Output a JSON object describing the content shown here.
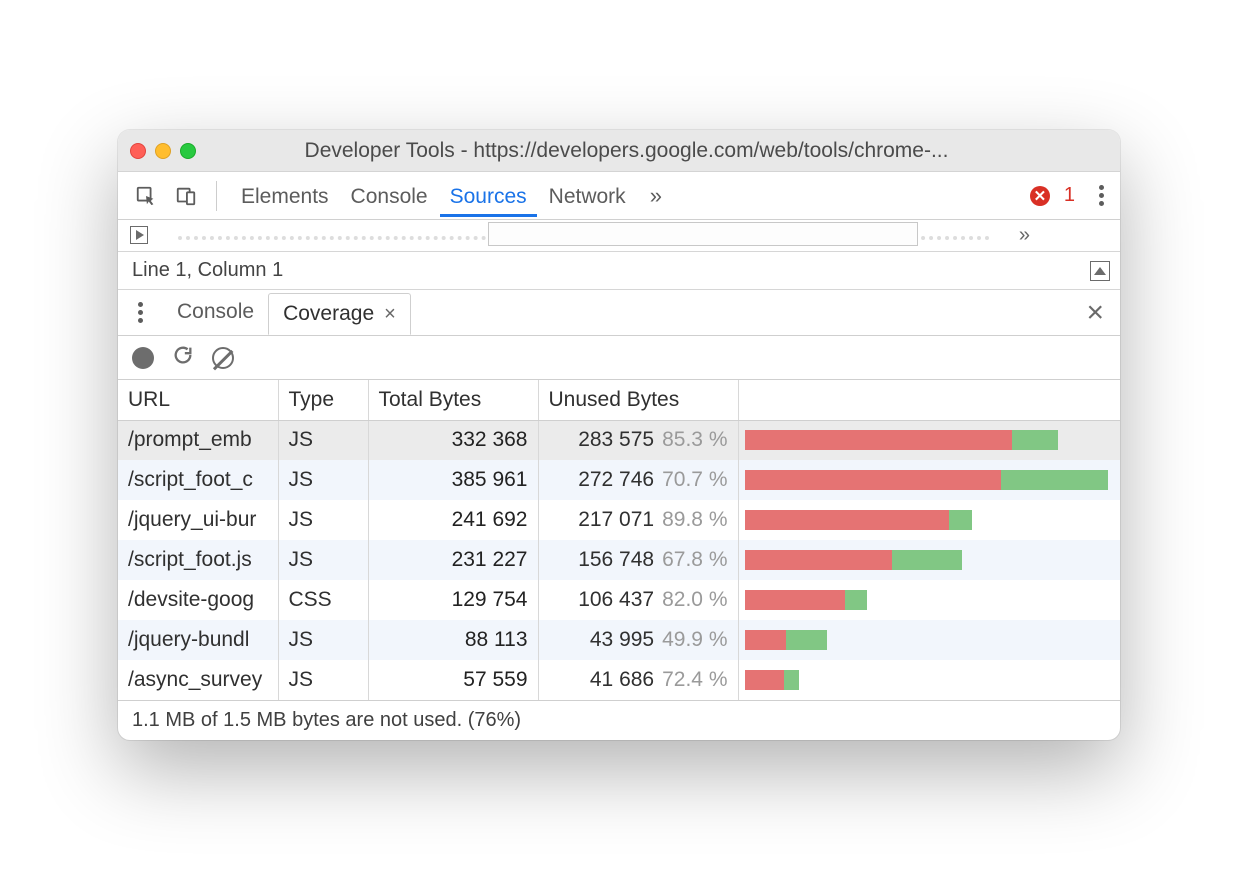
{
  "window": {
    "title": "Developer Tools - https://developers.google.com/web/tools/chrome-..."
  },
  "maintabs": {
    "items": [
      "Elements",
      "Console",
      "Sources",
      "Network"
    ],
    "active_index": 2,
    "error_count": "1"
  },
  "statusline": {
    "text": "Line 1, Column 1"
  },
  "drawer": {
    "tabs": [
      "Console",
      "Coverage"
    ],
    "active_index": 1
  },
  "coverage": {
    "headers": {
      "url": "URL",
      "type": "Type",
      "total": "Total Bytes",
      "unused": "Unused Bytes"
    },
    "max_total": 385961,
    "rows": [
      {
        "url": "/prompt_emb",
        "type": "JS",
        "total": "332 368",
        "total_n": 332368,
        "unused": "283 575",
        "pct": "85.3 %",
        "pct_n": 85.3,
        "selected": true
      },
      {
        "url": "/script_foot_c",
        "type": "JS",
        "total": "385 961",
        "total_n": 385961,
        "unused": "272 746",
        "pct": "70.7 %",
        "pct_n": 70.7
      },
      {
        "url": "/jquery_ui-bur",
        "type": "JS",
        "total": "241 692",
        "total_n": 241692,
        "unused": "217 071",
        "pct": "89.8 %",
        "pct_n": 89.8
      },
      {
        "url": "/script_foot.js",
        "type": "JS",
        "total": "231 227",
        "total_n": 231227,
        "unused": "156 748",
        "pct": "67.8 %",
        "pct_n": 67.8
      },
      {
        "url": "/devsite-goog",
        "type": "CSS",
        "total": "129 754",
        "total_n": 129754,
        "unused": "106 437",
        "pct": "82.0 %",
        "pct_n": 82.0
      },
      {
        "url": "/jquery-bundl",
        "type": "JS",
        "total": "88 113",
        "total_n": 88113,
        "unused": "43 995",
        "pct": "49.9 %",
        "pct_n": 49.9
      },
      {
        "url": "/async_survey",
        "type": "JS",
        "total": "57 559",
        "total_n": 57559,
        "unused": "41 686",
        "pct": "72.4 %",
        "pct_n": 72.4
      }
    ],
    "footer": "1.1 MB of 1.5 MB bytes are not used. (76%)"
  }
}
